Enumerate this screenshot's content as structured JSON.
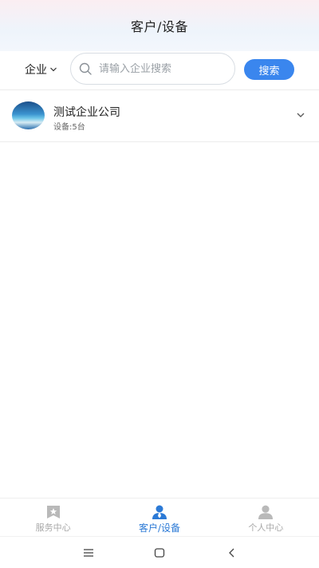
{
  "header": {
    "title": "客户/设备"
  },
  "search": {
    "filter_label": "企业",
    "placeholder": "请输入企业搜索",
    "value": "",
    "button_label": "搜索"
  },
  "companies": [
    {
      "name": "测试企业公司",
      "sub": "设备:5台"
    }
  ],
  "tabs": [
    {
      "label": "服务中心",
      "icon": "star-flag-icon",
      "active": false
    },
    {
      "label": "客户/设备",
      "icon": "customer-device-icon",
      "active": true
    },
    {
      "label": "个人中心",
      "icon": "person-icon",
      "active": false
    }
  ],
  "colors": {
    "accent": "#3a86ee",
    "tab_active": "#2c7ad6",
    "tab_inactive": "#a8a8a8"
  },
  "system_nav": [
    "menu-icon",
    "home-icon",
    "back-icon"
  ]
}
